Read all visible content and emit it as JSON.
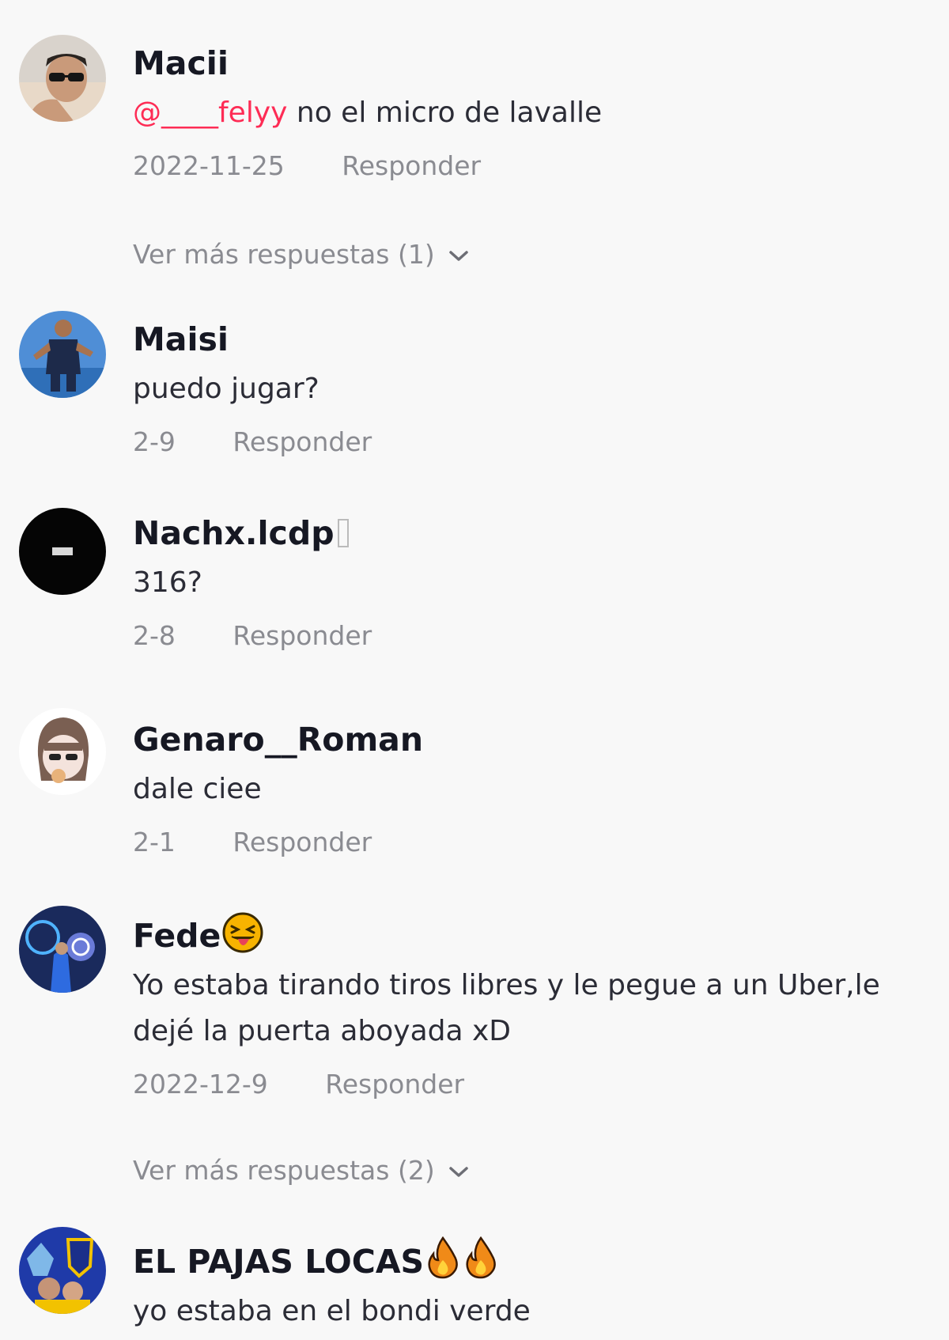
{
  "comments": [
    {
      "username": "Macii",
      "mention": "@____felyy",
      "text": " no el micro de lavalle",
      "date": "2022-11-25",
      "reply_label": "Responder",
      "more_replies": "Ver más respuestas (1)"
    },
    {
      "username": "Maisi",
      "text": "puedo jugar?",
      "date": "2-9",
      "reply_label": "Responder"
    },
    {
      "username": "Nachx.lcdp",
      "text": "316?",
      "date": "2-8",
      "reply_label": "Responder"
    },
    {
      "username": "Genaro__Roman",
      "text": "dale ciee",
      "date": "2-1",
      "reply_label": "Responder"
    },
    {
      "username": "Fede",
      "text": "Yo estaba tirando tiros libres y le pegue a un Uber,le dejé la puerta aboyada xD",
      "date": "2022-12-9",
      "reply_label": "Responder",
      "more_replies": "Ver más respuestas (2)"
    },
    {
      "username": "EL PAJAS LOCAS",
      "text": "yo estaba en el bondi verde"
    }
  ],
  "colors": {
    "mention": "#fe2c55",
    "meta": "#8a8b91",
    "background": "#f8f8f8"
  },
  "icons": {
    "chevron": "chevron-down-icon",
    "emoji_tongue": "squinting-tongue-emoji",
    "emoji_fire": "fire-emoji"
  }
}
